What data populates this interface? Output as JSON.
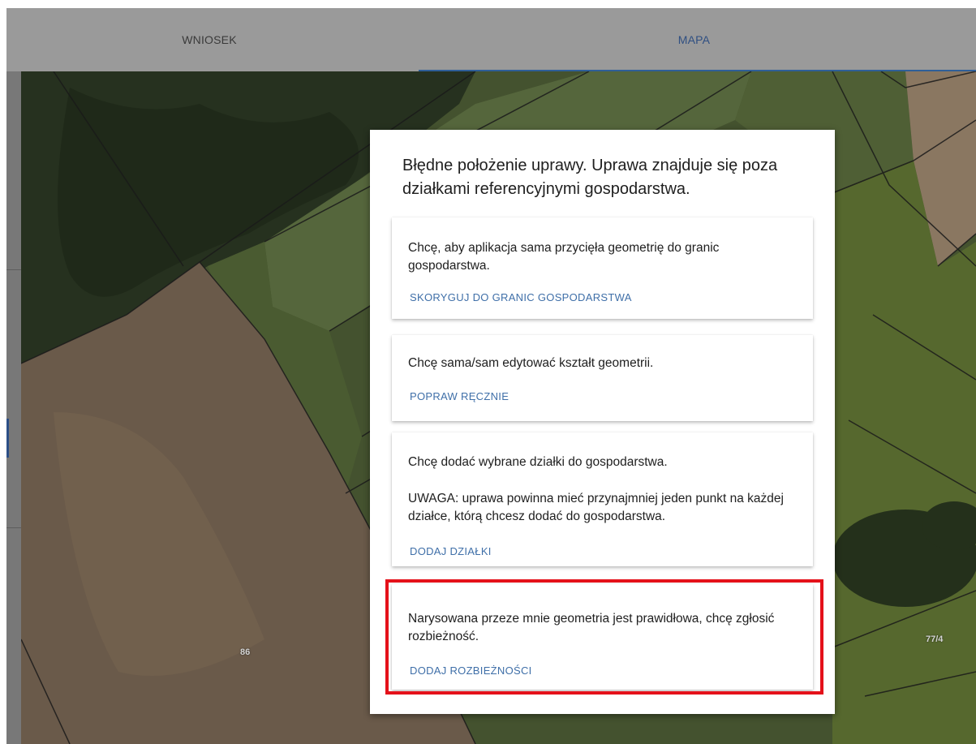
{
  "tabs": [
    {
      "label": "WNIOSEK"
    },
    {
      "label": "MAPA"
    }
  ],
  "map": {
    "parcel_labels": [
      "86",
      "77/4"
    ]
  },
  "dialog": {
    "title": "Błędne położenie uprawy. Uprawa znajduje się poza działkami referencyjnymi gospodarstwa.",
    "options": [
      {
        "text": "Chcę, aby aplikacja sama przycięła geometrię do granic gospodarstwa.",
        "action": "SKORYGUJ DO GRANIC GOSPODARSTWA"
      },
      {
        "text": "Chcę sama/sam edytować kształt geometrii.",
        "action": "POPRAW RĘCZNIE"
      },
      {
        "text": "Chcę dodać wybrane działki do gospodarstwa.",
        "note": "UWAGA: uprawa powinna mieć przynajmniej jeden punkt na każdej działce, którą chcesz dodać do gospodarstwa.",
        "action": "DODAJ DZIAŁKI"
      },
      {
        "text": "Narysowana przeze mnie geometria jest prawidłowa, chcę zgłosić rozbieżność.",
        "action": "DODAJ ROZBIEŻNOŚCI"
      }
    ]
  },
  "colors": {
    "tab_bar": "#9a9a9a",
    "accent": "#3f6fa8",
    "highlight": "#e4111a"
  }
}
